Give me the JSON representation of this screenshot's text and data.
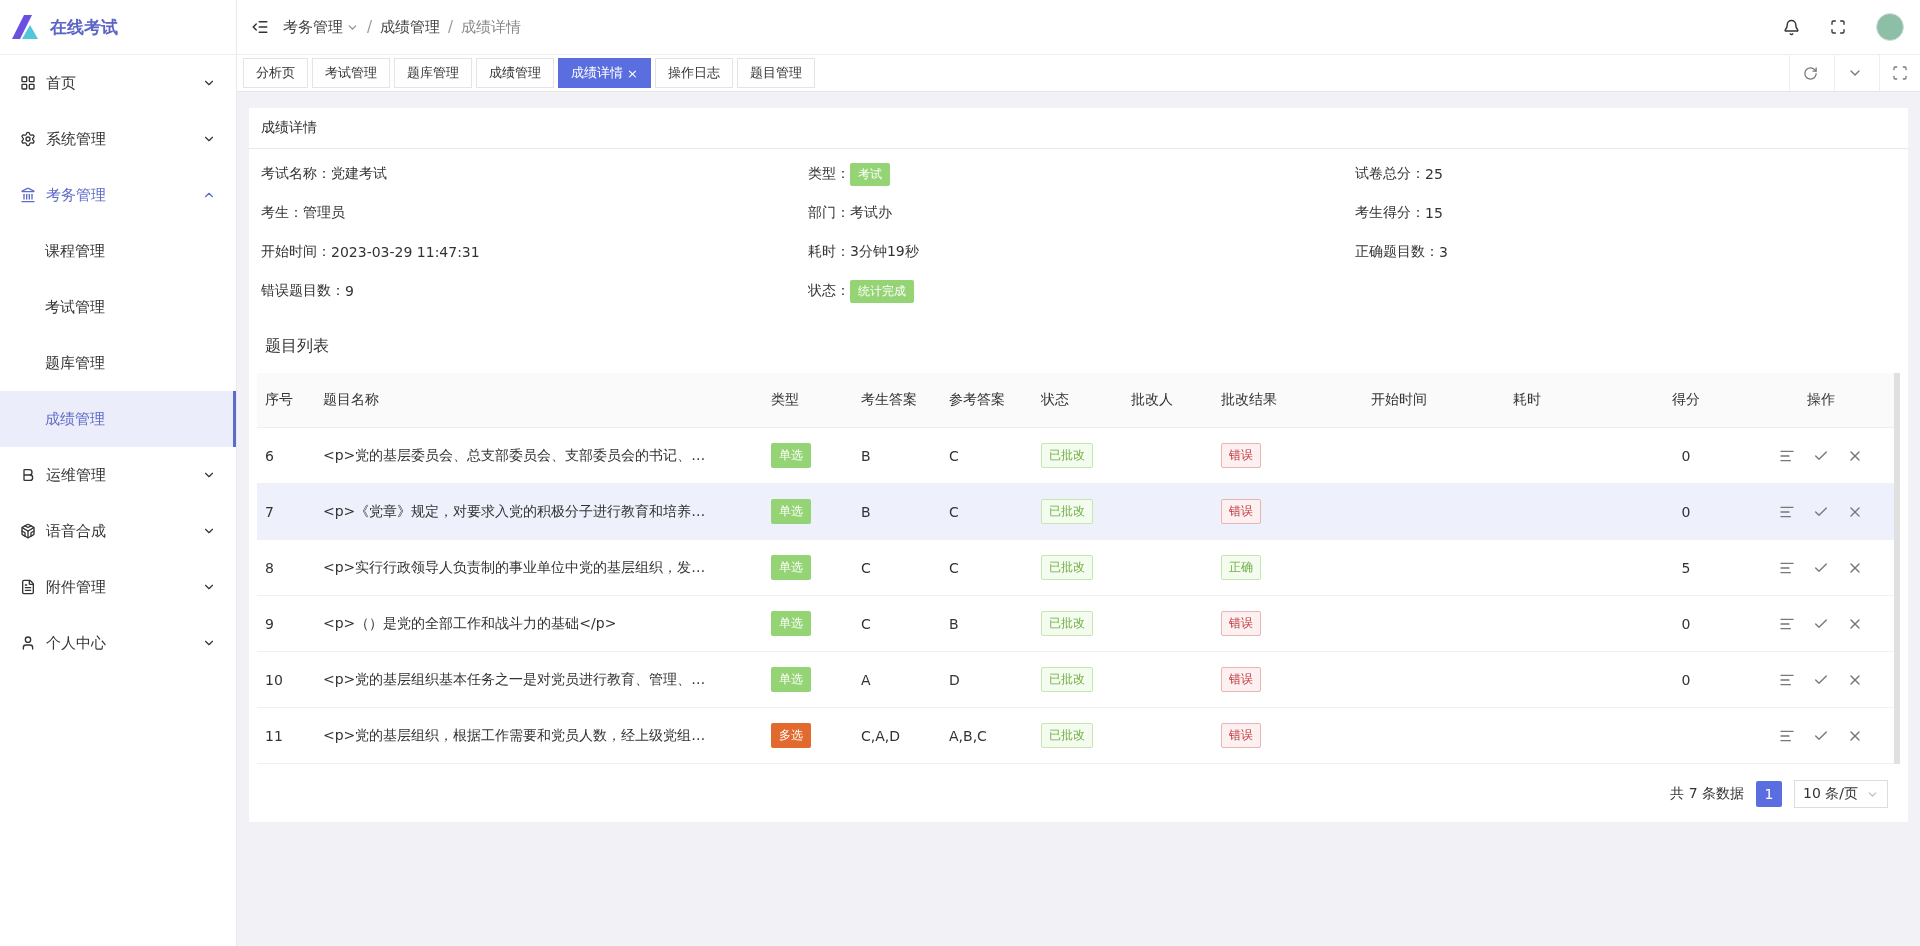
{
  "app": {
    "title": "在线考试"
  },
  "sidebar": {
    "items": [
      {
        "label": "首页",
        "expanded": false
      },
      {
        "label": "系统管理",
        "expanded": false
      },
      {
        "label": "考务管理",
        "expanded": true,
        "children": [
          {
            "label": "课程管理",
            "selected": false
          },
          {
            "label": "考试管理",
            "selected": false
          },
          {
            "label": "题库管理",
            "selected": false
          },
          {
            "label": "成绩管理",
            "selected": true
          }
        ]
      },
      {
        "label": "运维管理",
        "expanded": false
      },
      {
        "label": "语音合成",
        "expanded": false
      },
      {
        "label": "附件管理",
        "expanded": false
      },
      {
        "label": "个人中心",
        "expanded": false
      }
    ]
  },
  "breadcrumb": {
    "separator": "/",
    "items": [
      "考务管理",
      "成绩管理",
      "成绩详情"
    ]
  },
  "tabs": [
    {
      "label": "分析页",
      "selected": false
    },
    {
      "label": "考试管理",
      "selected": false
    },
    {
      "label": "题库管理",
      "selected": false
    },
    {
      "label": "成绩管理",
      "selected": false
    },
    {
      "label": "成绩详情",
      "selected": true,
      "close_mark": "×"
    },
    {
      "label": "操作日志",
      "selected": false
    },
    {
      "label": "题目管理",
      "selected": false
    }
  ],
  "card": {
    "title": "成绩详情",
    "fields": [
      {
        "label": "考试名称：",
        "value": "党建考试",
        "kind": "text"
      },
      {
        "label": "类型：",
        "value": "考试",
        "kind": "tag"
      },
      {
        "label": "试卷总分：",
        "value": "25",
        "kind": "text"
      },
      {
        "label": "考生：",
        "value": "管理员",
        "kind": "text"
      },
      {
        "label": "部门：",
        "value": "考试办",
        "kind": "text"
      },
      {
        "label": "考生得分：",
        "value": "15",
        "kind": "text"
      },
      {
        "label": "开始时间：",
        "value": "2023-03-29 11:47:31",
        "kind": "text"
      },
      {
        "label": "耗时：",
        "value": "3分钟19秒",
        "kind": "text"
      },
      {
        "label": "正确题目数：",
        "value": "3",
        "kind": "text"
      },
      {
        "label": "错误题目数：",
        "value": "9",
        "kind": "text"
      },
      {
        "label": "状态：",
        "value": "统计完成",
        "kind": "tag"
      }
    ],
    "section_title": "题目列表"
  },
  "table": {
    "columns": [
      "序号",
      "题目名称",
      "类型",
      "考生答案",
      "参考答案",
      "状态",
      "批改人",
      "批改结果",
      "开始时间",
      "耗时",
      "得分",
      "操作"
    ],
    "rows": [
      {
        "no": "6",
        "title": "<p>党的基层委员会、总支部委员会、支部委员会的书记、…",
        "type": {
          "text": "单选",
          "kind": "single"
        },
        "answer": "B",
        "reference": "C",
        "status": "已批改",
        "result": {
          "text": "错误",
          "kind": "wrong"
        },
        "score": "0",
        "selected": false
      },
      {
        "no": "7",
        "title": "<p>《党章》规定，对要求入党的积极分子进行教育和培养…",
        "type": {
          "text": "单选",
          "kind": "single"
        },
        "answer": "B",
        "reference": "C",
        "status": "已批改",
        "result": {
          "text": "错误",
          "kind": "wrong"
        },
        "score": "0",
        "selected": true
      },
      {
        "no": "8",
        "title": "<p>实行行政领导人负责制的事业单位中党的基层组织，发…",
        "type": {
          "text": "单选",
          "kind": "single"
        },
        "answer": "C",
        "reference": "C",
        "status": "已批改",
        "result": {
          "text": "正确",
          "kind": "right"
        },
        "score": "5",
        "selected": false
      },
      {
        "no": "9",
        "title": "<p>（）是党的全部工作和战斗力的基础</p>",
        "type": {
          "text": "单选",
          "kind": "single"
        },
        "answer": "C",
        "reference": "B",
        "status": "已批改",
        "result": {
          "text": "错误",
          "kind": "wrong"
        },
        "score": "0",
        "selected": false
      },
      {
        "no": "10",
        "title": "<p>党的基层组织基本任务之一是对党员进行教育、管理、…",
        "type": {
          "text": "单选",
          "kind": "single"
        },
        "answer": "A",
        "reference": "D",
        "status": "已批改",
        "result": {
          "text": "错误",
          "kind": "wrong"
        },
        "score": "0",
        "selected": false
      },
      {
        "no": "11",
        "title": "<p>党的基层组织，根据工作需要和党员人数，经上级党组…",
        "type": {
          "text": "多选",
          "kind": "multi"
        },
        "answer": "C,A,D",
        "reference": "A,B,C",
        "status": "已批改",
        "result": {
          "text": "错误",
          "kind": "wrong"
        },
        "selected": false
      }
    ]
  },
  "pagination": {
    "total": "共 7 条数据",
    "pages": [
      {
        "label": "1",
        "selected": true
      }
    ],
    "page_size": "10 条/页"
  }
}
